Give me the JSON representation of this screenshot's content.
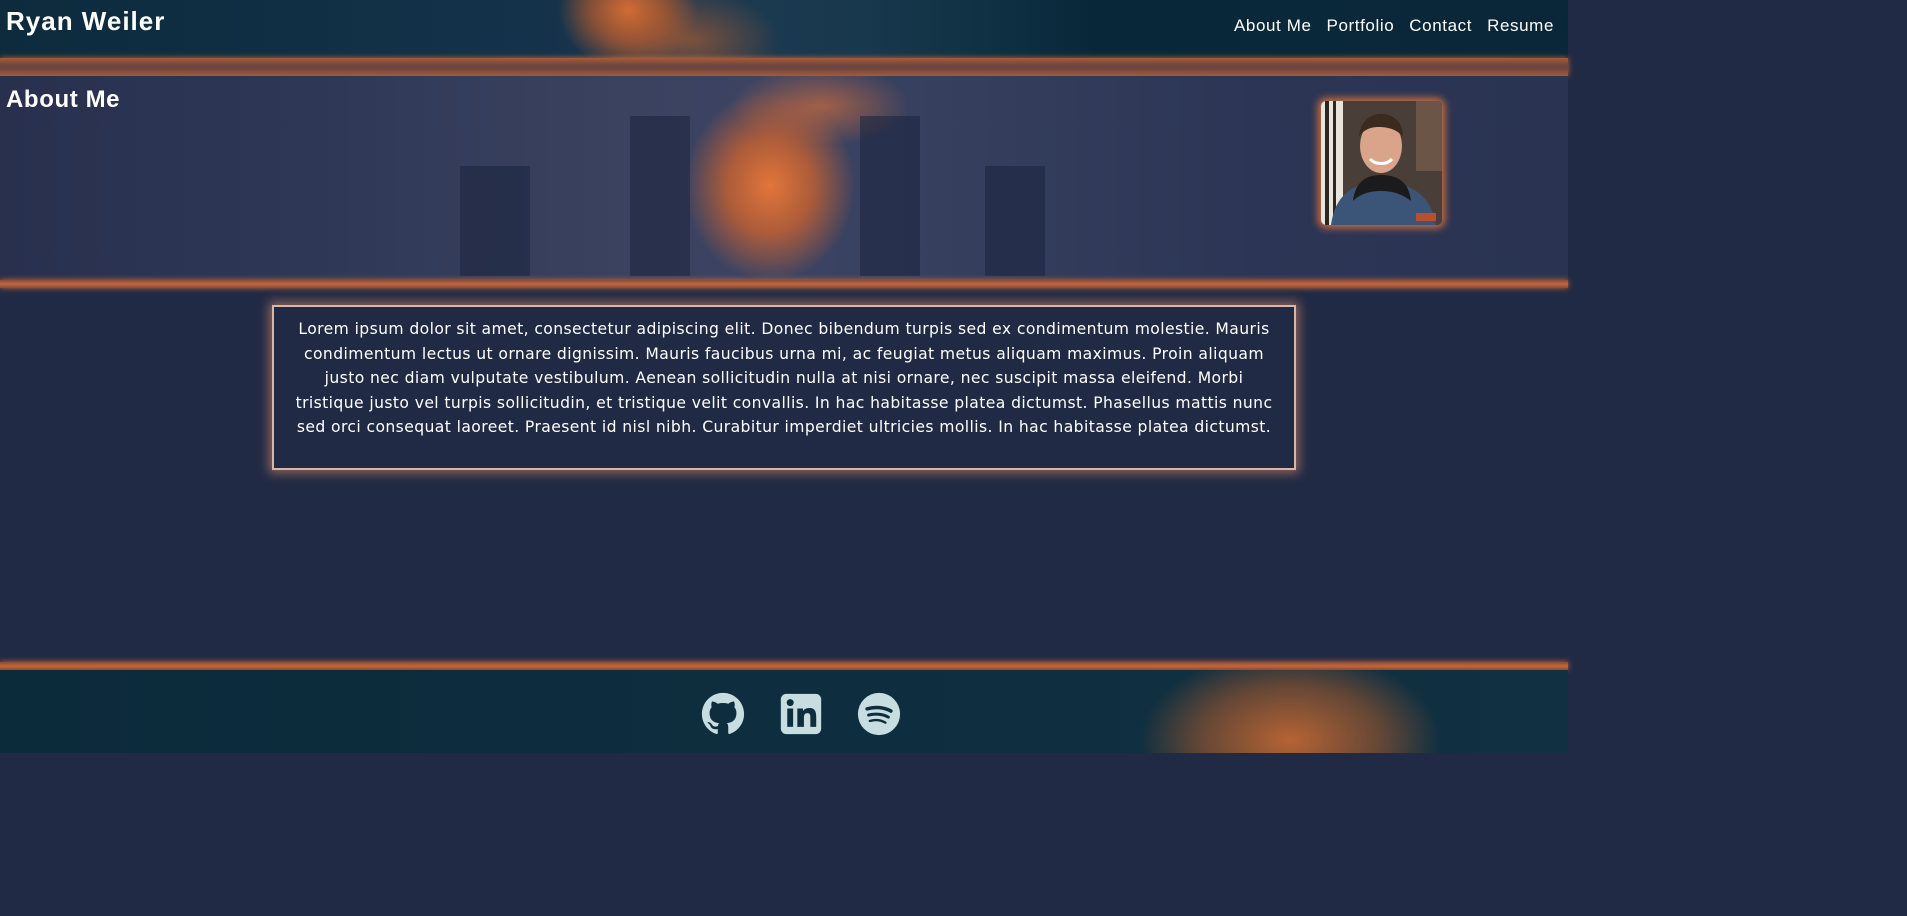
{
  "header": {
    "site_title": "Ryan Weiler",
    "nav": [
      {
        "label": "About Me"
      },
      {
        "label": "Portfolio"
      },
      {
        "label": "Contact"
      },
      {
        "label": "Resume"
      }
    ]
  },
  "hero": {
    "title": "About Me"
  },
  "bio": {
    "text": "Lorem ipsum dolor sit amet, consectetur adipiscing elit. Donec bibendum turpis sed ex condimentum molestie. Mauris condimentum lectus ut ornare dignissim. Mauris faucibus urna mi, ac feugiat metus aliquam maximus. Proin aliquam justo nec diam vulputate vestibulum. Aenean sollicitudin nulla at nisi ornare, nec suscipit massa eleifend. Morbi tristique justo vel turpis sollicitudin, et tristique velit convallis. In hac habitasse platea dictumst. Phasellus mattis nunc sed orci consequat laoreet. Praesent id nisl nibh. Curabitur imperdiet ultricies mollis. In hac habitasse platea dictumst."
  },
  "footer": {
    "icons": [
      "github-icon",
      "linkedin-icon",
      "spotify-icon"
    ]
  },
  "colors": {
    "accent": "#c0683e",
    "background": "#212a45",
    "icon": "#c7dde0"
  }
}
